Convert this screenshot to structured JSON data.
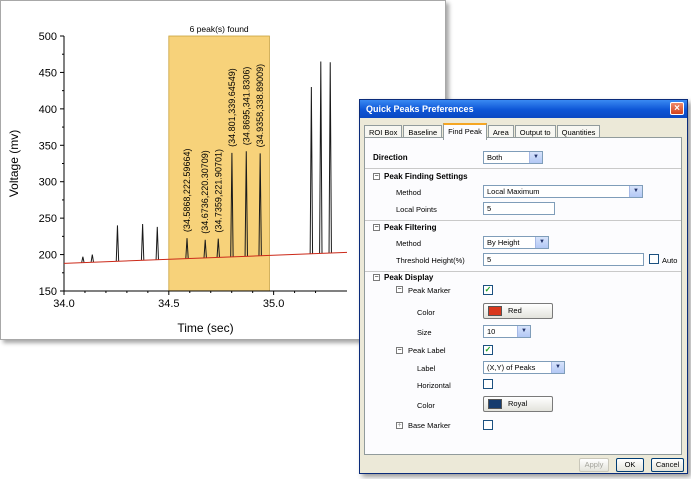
{
  "chart_data": {
    "type": "line",
    "xlabel": "Time (sec)",
    "ylabel": "Voltage (mv)",
    "xlim": [
      34.0,
      35.35
    ],
    "ylim": [
      150,
      500
    ],
    "xticks": [
      "34.0",
      "34.5",
      "35.0"
    ],
    "yticks": [
      "150",
      "200",
      "250",
      "300",
      "350",
      "400",
      "450",
      "500"
    ],
    "roi_label": "6 peak(s) found",
    "roi_range": [
      34.5,
      34.98
    ],
    "baseline": {
      "start_value": 188,
      "end_value": 203
    },
    "peaks": [
      {
        "x": 34.09,
        "y": 197
      },
      {
        "x": 34.135,
        "y": 200
      },
      {
        "x": 34.255,
        "y": 240
      },
      {
        "x": 34.375,
        "y": 242
      },
      {
        "x": 34.445,
        "y": 238
      },
      {
        "x": 34.5868,
        "y": 222.59664
      },
      {
        "x": 34.6736,
        "y": 220.30709
      },
      {
        "x": 34.7359,
        "y": 221.90701
      },
      {
        "x": 34.801,
        "y": 339.64549
      },
      {
        "x": 34.8695,
        "y": 341.8306
      },
      {
        "x": 34.9358,
        "y": 338.89009
      },
      {
        "x": 35.18,
        "y": 430
      },
      {
        "x": 35.225,
        "y": 465
      },
      {
        "x": 35.27,
        "y": 464
      }
    ],
    "peak_labels": [
      "(34.5868,222.59664)",
      "(34.6736,220.30709)",
      "(34.7359,221.90701)",
      "(34.801,339.64549)",
      "(34.8695,341.8306)",
      "(34.9358,338.89009)"
    ],
    "colors": {
      "signal": "#1a1a1a",
      "baseline": "#cc2a1a",
      "roi_fill": "#f7d27a",
      "roi_border": "#c9a23c"
    }
  },
  "dialog": {
    "title": "Quick Peaks Preferences",
    "close_glyph": "×",
    "tabs": [
      "ROI Box",
      "Baseline",
      "Find Peak",
      "Area",
      "Output to",
      "Quantities"
    ],
    "active_tab": "Find Peak",
    "direction": {
      "label": "Direction",
      "value": "Both"
    },
    "peak_finding": {
      "title": "Peak Finding Settings",
      "method_label": "Method",
      "method_value": "Local Maximum",
      "local_points_label": "Local Points",
      "local_points_value": "5"
    },
    "peak_filtering": {
      "title": "Peak Filtering",
      "method_label": "Method",
      "method_value": "By Height",
      "threshold_label": "Threshold Height(%)",
      "threshold_value": "5",
      "auto_label": "Auto",
      "auto_checked": false
    },
    "peak_display": {
      "title": "Peak Display",
      "marker": {
        "label": "Peak Marker",
        "checked": true,
        "color_label": "Color",
        "color_value": "Red",
        "color_hex": "#d9381e",
        "size_label": "Size",
        "size_value": "10"
      },
      "label": {
        "label": "Peak Label",
        "checked": true,
        "label_label": "Label",
        "label_value": "(X,Y) of Peaks",
        "horizontal_label": "Horizontal",
        "horizontal_checked": false,
        "color_label": "Color",
        "color_value": "Royal",
        "color_hex": "#153b6e"
      },
      "base_marker": {
        "label": "Base Marker",
        "checked": false
      }
    },
    "buttons": {
      "apply": "Apply",
      "ok": "OK",
      "cancel": "Cancel"
    }
  }
}
